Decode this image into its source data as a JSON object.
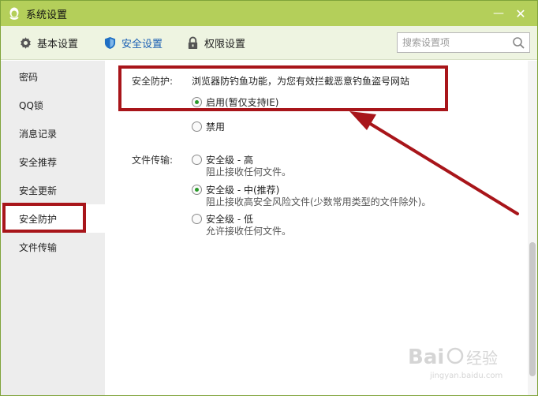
{
  "window": {
    "title": "系统设置"
  },
  "titlebar": {
    "minimize_label": "—",
    "close_label": "✕"
  },
  "toolbar": {
    "tabs": [
      {
        "label": "基本设置",
        "icon": "gear-icon",
        "active": false
      },
      {
        "label": "安全设置",
        "icon": "shield-icon",
        "active": true
      },
      {
        "label": "权限设置",
        "icon": "lock-icon",
        "active": false
      }
    ],
    "search": {
      "placeholder": "搜索设置项",
      "value": ""
    }
  },
  "sidebar": {
    "items": [
      {
        "label": "密码"
      },
      {
        "label": "QQ锁"
      },
      {
        "label": "消息记录"
      },
      {
        "label": "安全推荐"
      },
      {
        "label": "安全更新"
      },
      {
        "label": "安全防护",
        "active": true
      },
      {
        "label": "文件传输"
      }
    ]
  },
  "security_protection": {
    "label": "安全防护:",
    "description": "浏览器防钓鱼功能，为您有效拦截恶意钓鱼盗号网站",
    "options": [
      {
        "label": "启用(暂仅支持IE)",
        "checked": true
      },
      {
        "label": "禁用",
        "checked": false
      }
    ]
  },
  "file_transfer": {
    "label": "文件传输:",
    "options": [
      {
        "label": "安全级 - 高",
        "sub": "阻止接收任何文件。",
        "checked": false
      },
      {
        "label": "安全级 - 中(推荐)",
        "sub": "阻止接收高安全风险文件(少数常用类型的文件除外)。",
        "checked": true
      },
      {
        "label": "安全级 - 低",
        "sub": "允许接收任何文件。",
        "checked": false
      }
    ]
  },
  "colors": {
    "highlight": "#a8151a",
    "titlebar": "#b4cf5a",
    "active_tab": "#1a5fb4"
  },
  "watermark": {
    "text_main": "Bai",
    "text_cn": "经验",
    "url": "jingyan.baidu.com"
  }
}
